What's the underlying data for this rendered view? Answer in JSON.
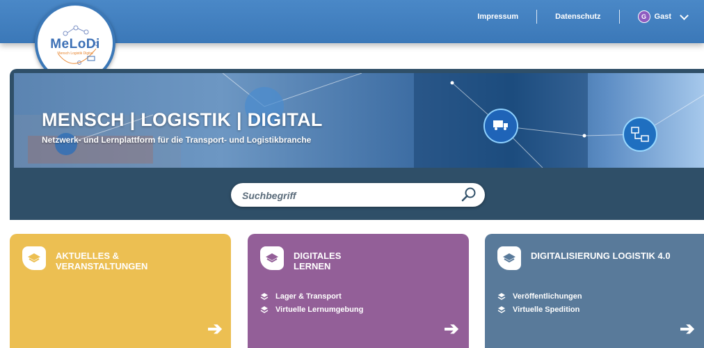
{
  "nav": {
    "links": [
      "Impressum",
      "Datenschutz"
    ],
    "user_initial": "G",
    "user_name": "Gast"
  },
  "logo": {
    "name": "MeLoDi",
    "subtitle": "Mensch Logistik Digital"
  },
  "hero": {
    "title": "MENSCH | LOGISTIK | DIGITAL",
    "subtitle": "Netzwerk- und Lernplattform für die Transport- und Logistikbranche"
  },
  "search": {
    "placeholder": "Suchbegriff"
  },
  "cards": [
    {
      "title_line1": "AKTUELLES &",
      "title_line2": "VERANSTALTUNGEN",
      "items": [],
      "color": "#ecbf52"
    },
    {
      "title_line1": "DIGITALES",
      "title_line2": "LERNEN",
      "items": [
        "Lager & Transport",
        "Virtuelle Lernumgebung"
      ],
      "color": "#935f98"
    },
    {
      "title_line1": "DIGITALISIERUNG LOGISTIK 4.0",
      "title_line2": "",
      "items": [
        "Veröffentlichungen",
        "Virtuelle Spedition"
      ],
      "color": "#597a9a"
    }
  ],
  "colors": {
    "topbar": "#3b78b8",
    "hero_panel": "#2f4f68"
  },
  "icons": [
    "layers-icon",
    "search-icon",
    "arrow-right-icon",
    "chevron-down-icon",
    "truck-icon",
    "network-icon"
  ]
}
